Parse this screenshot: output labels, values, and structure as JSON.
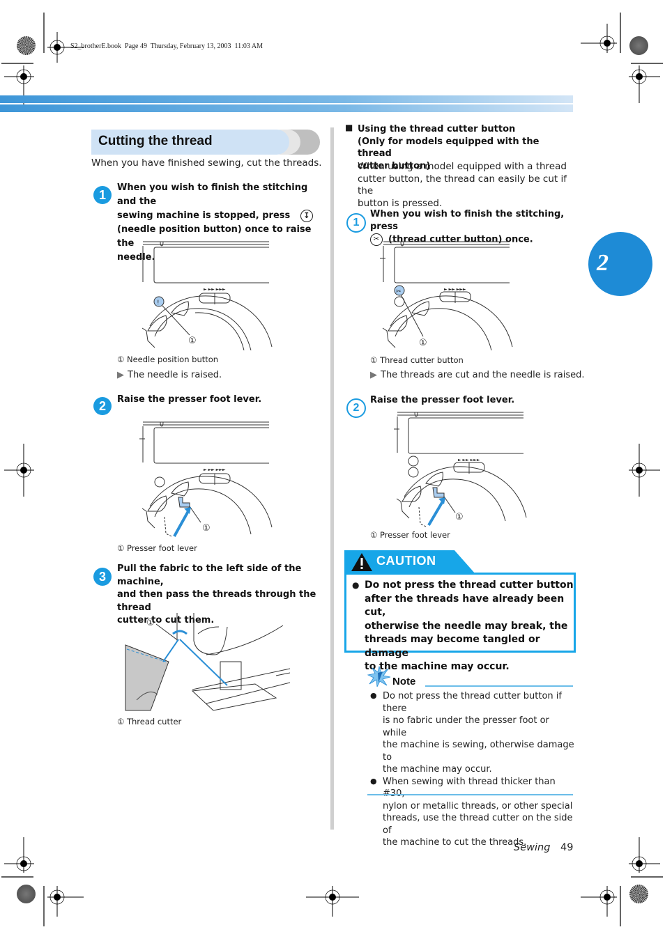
{
  "print_header": "S2_brotherE.book  Page 49  Thursday, February 13, 2003  11:03 AM",
  "chapter_tab": "2",
  "colors": {
    "accent": "#1a9be0",
    "title_band": "#cfe2f5",
    "caution": "#17a6e8",
    "chapter": "#1e8bd6"
  },
  "left": {
    "title": "Cutting the thread",
    "intro": "When you have finished sewing, cut the threads.",
    "steps": [
      {
        "number": "1",
        "lines": [
          "When you wish to finish the stitching and the",
          "sewing machine is stopped, press",
          "(needle position button) once to raise the",
          "needle."
        ],
        "inline_icon": "needle-position-icon",
        "figure_callout": "①",
        "caption": "① Needle position button",
        "result": "The needle is raised."
      },
      {
        "number": "2",
        "lines": [
          "Raise the presser foot lever."
        ],
        "figure_callout": "①",
        "caption": "① Presser foot lever"
      },
      {
        "number": "3",
        "lines": [
          "Pull the fabric to the left side of the machine,",
          "and then pass the threads through the thread",
          "cutter to cut them."
        ],
        "figure_callout": "①",
        "caption": "① Thread cutter"
      }
    ]
  },
  "right": {
    "subheading_bullet": "■",
    "subheading_lines": [
      "Using the thread cutter button",
      "(Only for models equipped with the thread",
      "cutter button)"
    ],
    "subheading_body": [
      "When using a model equipped with a thread",
      "cutter button, the thread can easily be cut if the",
      "button is pressed."
    ],
    "steps": [
      {
        "number": "1",
        "lines": [
          "When you wish to finish the stitching, press",
          "(thread cutter button) once."
        ],
        "inline_icon": "thread-cutter-icon",
        "figure_callout": "①",
        "caption": "① Thread cutter button",
        "result": "The threads are cut and the needle is raised."
      },
      {
        "number": "2",
        "lines": [
          "Raise the presser foot lever."
        ],
        "figure_callout": "①",
        "caption": "① Presser foot lever"
      }
    ],
    "caution": {
      "label": "CAUTION",
      "bullet": "●",
      "lines": [
        "Do not press the thread cutter button",
        "after the threads have already been cut,",
        "otherwise the needle may break, the",
        "threads may become tangled or damage",
        "to the machine may occur."
      ]
    },
    "note": {
      "label": "Note",
      "bullet": "●",
      "items": [
        [
          "Do not press the thread cutter button if there",
          "is no fabric under the presser foot or while",
          "the machine is sewing, otherwise damage to",
          "the machine may occur."
        ],
        [
          "When sewing with thread thicker than #30,",
          "nylon or metallic threads, or other special",
          "threads, use the thread cutter on the side of",
          "the machine to cut the threads."
        ]
      ]
    }
  },
  "result_marker": "▶",
  "footer": {
    "section": "Sewing",
    "page": "49"
  }
}
